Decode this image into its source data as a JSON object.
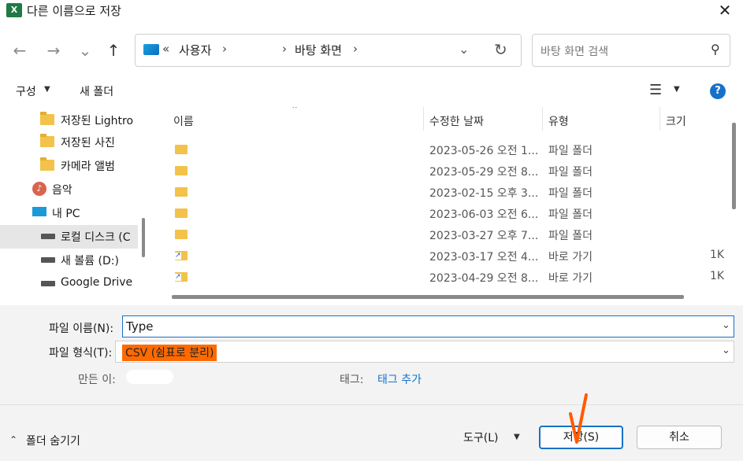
{
  "window": {
    "title": "다른 이름으로 저장",
    "app_icon": "excel-icon"
  },
  "nav": {
    "back": "←",
    "forward": "→",
    "recent": "⌄",
    "up": "↑"
  },
  "address": {
    "overflow": "«",
    "crumbs": [
      "사용자",
      "바탕 화면"
    ],
    "separator": "›"
  },
  "search": {
    "placeholder": "바탕 화면 검색"
  },
  "toolbar": {
    "organize": "구성",
    "new_folder": "새 폴더",
    "help": "?"
  },
  "nav_pane": {
    "items": [
      {
        "label": "저장된 Lightro",
        "icon": "folder-icon"
      },
      {
        "label": "저장된 사진",
        "icon": "folder-icon"
      },
      {
        "label": "카메라 앨범",
        "icon": "folder-icon"
      },
      {
        "label": "음악",
        "icon": "music-icon"
      },
      {
        "label": "내 PC",
        "icon": "pc-icon"
      },
      {
        "label": "로컬 디스크 (C",
        "icon": "drive-icon"
      },
      {
        "label": "새 볼륨 (D:)",
        "icon": "drive-icon"
      },
      {
        "label": "Google Drive",
        "icon": "drive-icon"
      }
    ]
  },
  "file_list": {
    "columns": [
      "이름",
      "수정한 날짜",
      "유형",
      "크기"
    ],
    "rows": [
      {
        "name": "",
        "date": "2023-05-26 오전 1...",
        "type": "파일 폴더",
        "size": "",
        "shortcut": false
      },
      {
        "name": "",
        "date": "2023-05-29 오전 8...",
        "type": "파일 폴더",
        "size": "",
        "shortcut": false
      },
      {
        "name": "",
        "date": "2023-02-15 오후 3...",
        "type": "파일 폴더",
        "size": "",
        "shortcut": false
      },
      {
        "name": "",
        "date": "2023-06-03 오전 6...",
        "type": "파일 폴더",
        "size": "",
        "shortcut": false
      },
      {
        "name": "",
        "date": "2023-03-27 오후 7...",
        "type": "파일 폴더",
        "size": "",
        "shortcut": false
      },
      {
        "name": "",
        "date": "2023-03-17 오전 4...",
        "type": "바로 가기",
        "size": "1K",
        "shortcut": true
      },
      {
        "name": "",
        "date": "2023-04-29 오전 8...",
        "type": "바로 가기",
        "size": "1K",
        "shortcut": true
      }
    ]
  },
  "form": {
    "filename_label": "파일 이름(N):",
    "filename_value": "Type",
    "filetype_label": "파일 형식(T):",
    "filetype_value": "CSV (쉼표로 분리)",
    "author_label": "만든 이:",
    "tags_label": "태그:",
    "tags_link": "태그 추가"
  },
  "footer": {
    "hide_folders": "폴더 숨기기",
    "tools": "도구(L)",
    "save": "저장(S)",
    "cancel": "취소"
  },
  "colors": {
    "accent": "#1672c9",
    "highlight": "#ff6a00",
    "folder": "#f3c24a"
  }
}
